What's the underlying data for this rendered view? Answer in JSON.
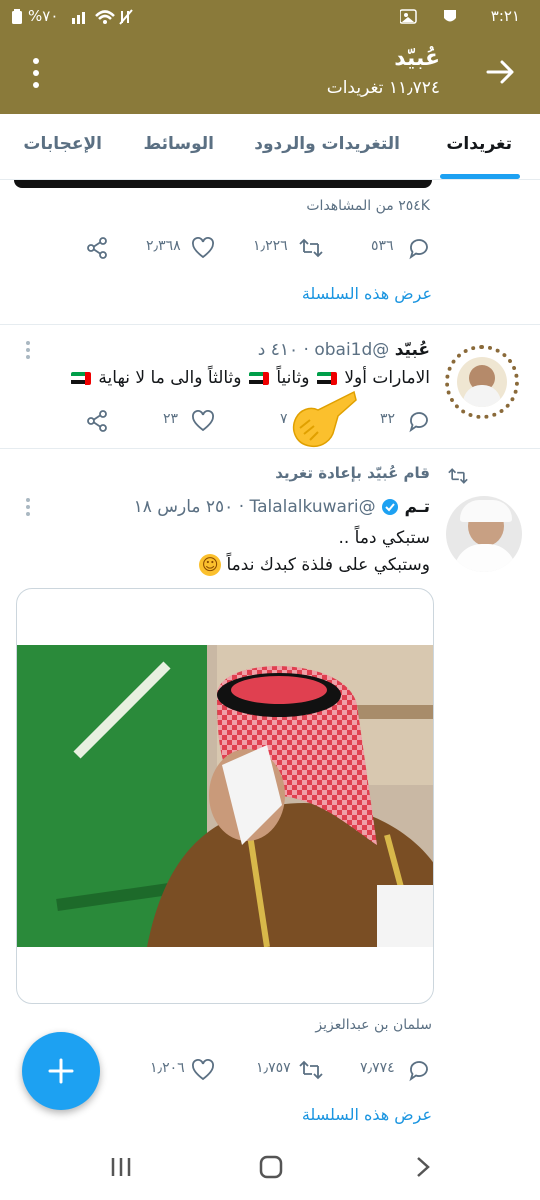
{
  "status_bar": {
    "time": "٣:٢١",
    "battery": "%٧٠"
  },
  "header": {
    "name": "عُبيّد",
    "tweet_count": "١١٫٧٢٤ تغريدات"
  },
  "tabs": [
    {
      "label": "تغريدات",
      "active": true
    },
    {
      "label": "التغريدات والردود"
    },
    {
      "label": "الوسائط"
    },
    {
      "label": "الإعجابات"
    }
  ],
  "tweet1": {
    "views": "٢٥٤K من المشاهدات",
    "replies": "٥٣٦",
    "retweets": "١٫٢٢٦",
    "likes": "٢٫٣٦٨",
    "show_thread": "عرض هذه السلسلة"
  },
  "tweet2": {
    "name": "عُبيّد",
    "handle": "@obai1d",
    "time": "٤١٠ د",
    "text_parts": [
      "الامارات أولا",
      "وثانياً",
      "وثالثاً والى ما لا نهاية"
    ],
    "replies": "٣٢",
    "retweets": "٧",
    "likes": "٢٣"
  },
  "tweet3": {
    "retweet_label": "قام عُبيّد بإعادة تغريد",
    "name": "تـم",
    "handle": "@Talalalkuwari",
    "time": "٢٥٠ مارس ١٨",
    "line1": "ستبكي دماً ..",
    "line2": "وستبكي على فلذة كبدك ندماً",
    "emoji": "☺",
    "caption": "سلمان بن عبدالعزيز",
    "replies": "٧٫٧٧٤",
    "retweets": "١٫٧٥٧",
    "likes": "١٫٢٠٦",
    "show_thread": "عرض هذه السلسلة"
  },
  "colors": {
    "header": "#8a7a3a",
    "accent": "#1da1f2",
    "link": "#1b95e0"
  }
}
